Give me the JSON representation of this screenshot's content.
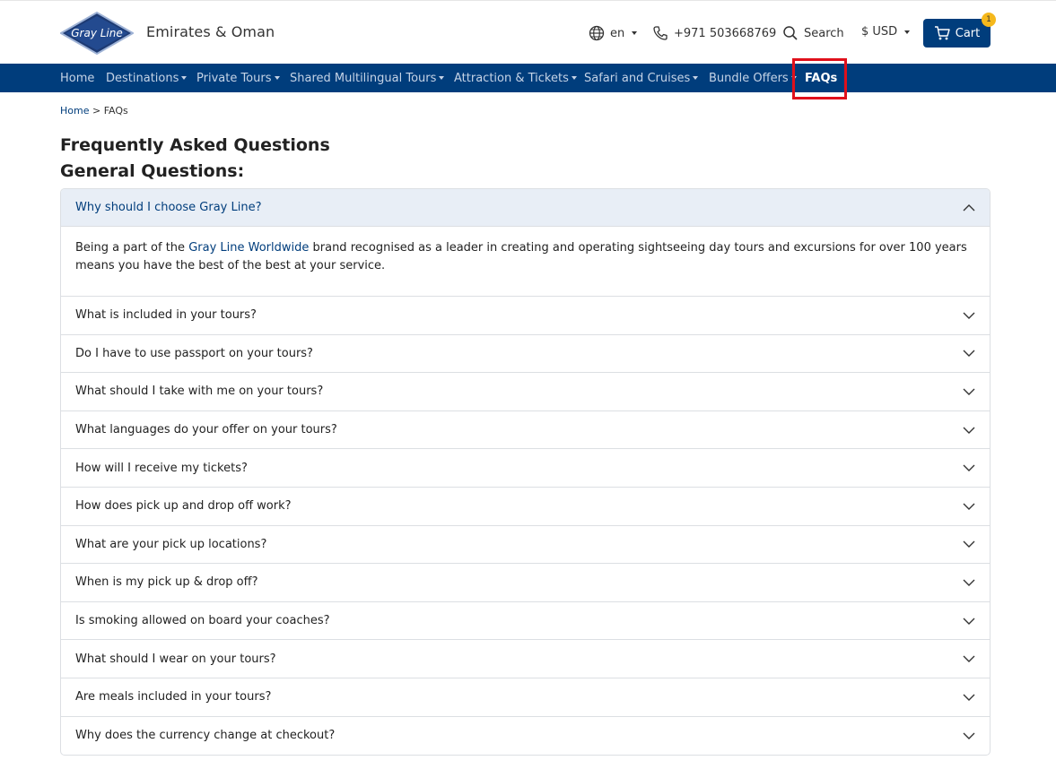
{
  "header": {
    "logo_text": "Gray Line",
    "site_name": "Emirates & Oman",
    "language": "en",
    "phone": "+971 503668769",
    "search_label": "Search",
    "currency": "$ USD",
    "cart_label": "Cart",
    "cart_count": "1"
  },
  "nav": {
    "items": [
      {
        "label": "Home"
      },
      {
        "label": "Destinations"
      },
      {
        "label": "Private Tours"
      },
      {
        "label": "Shared Multilingual Tours"
      },
      {
        "label": "Attraction & Tickets"
      },
      {
        "label": "Safari and Cruises"
      },
      {
        "label": "Bundle Offers"
      },
      {
        "label": "FAQs"
      }
    ]
  },
  "breadcrumb": {
    "home": "Home",
    "separator": ">",
    "current": "FAQs"
  },
  "page": {
    "title": "Frequently Asked Questions",
    "subtitle": "General Questions:"
  },
  "faq": {
    "open": {
      "question": "Why should I choose Gray Line?",
      "answer_before": "Being a part of the ",
      "answer_link": "Gray Line Worldwide",
      "answer_after": " brand recognised as a leader in creating and operating sightseeing day tours and excursions for over 100 years means you have the best of the best at your service."
    },
    "items": [
      "What is included in your tours?",
      "Do I have to use passport on your tours?",
      "What should I take with me on your tours?",
      "What languages do your offer on your tours?",
      "How will I receive my tickets?",
      "How does pick up and drop off work?",
      "What are your pick up locations?",
      "When is my pick up & drop off?",
      "Is smoking allowed on board your coaches?",
      "What should I wear on your tours?",
      "Are meals included in your tours?",
      "Why does the currency change at checkout?"
    ]
  },
  "colors": {
    "brand": "#003d7c",
    "highlight": "#e0101b",
    "badge": "#f5b81c"
  }
}
